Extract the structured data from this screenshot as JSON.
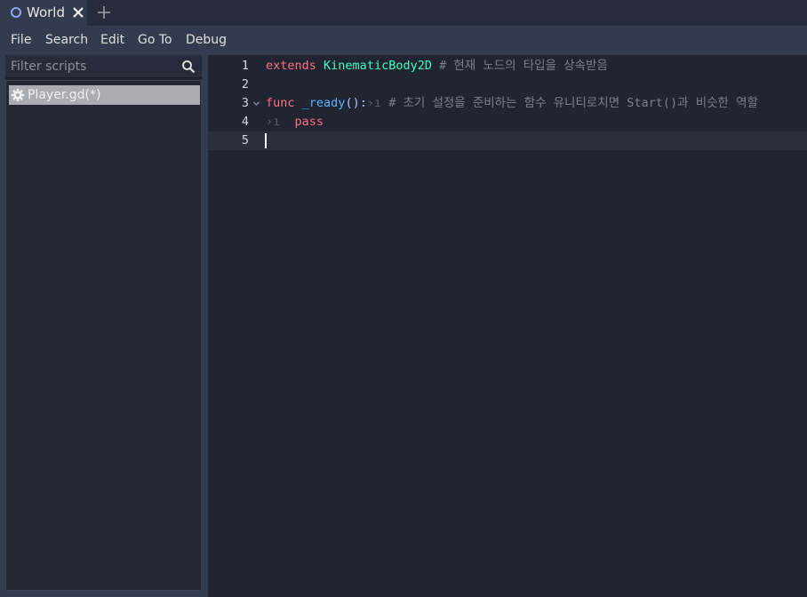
{
  "tabs": [
    {
      "label": "World"
    }
  ],
  "menu": {
    "file": "File",
    "search": "Search",
    "edit": "Edit",
    "goto": "Go To",
    "debug": "Debug"
  },
  "scripts_panel": {
    "filter_placeholder": "Filter scripts",
    "items": [
      {
        "label": "Player.gd(*)"
      }
    ]
  },
  "editor": {
    "line_numbers": [
      "1",
      "2",
      "3",
      "4",
      "5"
    ],
    "line1": {
      "keyword": "extends",
      "class": "KinematicBody2D",
      "comment": "# 현재 노드의 타입을 상속받음"
    },
    "line3": {
      "keyword": "func",
      "name": "_ready",
      "parens": "():",
      "comment": "# 초기 설정을 준비하는 함수 유니티로치면 Start()과 비슷한 역할"
    },
    "line4": {
      "keyword": "pass"
    },
    "current_line": 5
  },
  "colors": {
    "keyword": "#ff7085",
    "class": "#42ffc2",
    "function": "#57b3ff",
    "comment": "#7a808c",
    "accent": "#8da5f3"
  }
}
